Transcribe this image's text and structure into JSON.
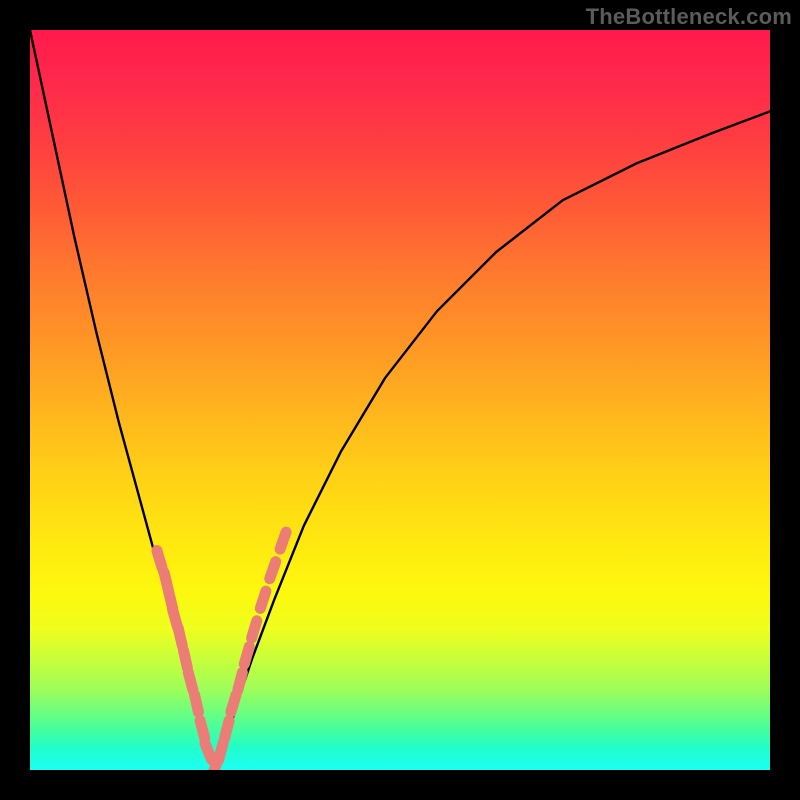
{
  "watermark": "TheBottleneck.com",
  "colors": {
    "frame": "#000000",
    "curve": "#000000",
    "marker": "#ec7d76",
    "gradient_stops": [
      "#ff1a4d",
      "#ff2b4a",
      "#ff4040",
      "#ff5a36",
      "#ff7a2e",
      "#ff9526",
      "#ffb31e",
      "#ffd016",
      "#ffe810",
      "#fdf80e",
      "#eefe1e",
      "#c8fe3a",
      "#9ffe59",
      "#6ffe7d",
      "#3efea4",
      "#21fecb",
      "#1cfff2"
    ]
  },
  "chart_data": {
    "type": "line",
    "title": "",
    "xlabel": "",
    "ylabel": "",
    "xlim": [
      0,
      100
    ],
    "ylim": [
      0,
      100
    ],
    "note": "V-shaped bottleneck curve. x is a normalized parameter (0–100), y is bottleneck percentage (0 at the balanced point, rising toward 100 away from it). Values are estimated from pixel positions; no axis ticks or labels are visible in the image.",
    "series": [
      {
        "name": "bottleneck-curve",
        "x": [
          0,
          3,
          6,
          9,
          12,
          15,
          18,
          20,
          22,
          23.5,
          25,
          26.5,
          28,
          30,
          33,
          37,
          42,
          48,
          55,
          63,
          72,
          82,
          92,
          100
        ],
        "y": [
          100,
          86,
          72,
          59,
          47,
          36,
          25,
          17,
          10,
          4,
          0,
          4,
          9,
          15,
          23,
          33,
          43,
          53,
          62,
          70,
          77,
          82,
          86,
          89
        ]
      }
    ],
    "markers": {
      "name": "highlighted-points",
      "note": "Salmon-colored marker segments clustered near the minimum of the curve.",
      "x": [
        17.5,
        18.4,
        19.0,
        19.6,
        20.3,
        21.0,
        21.7,
        22.5,
        23.3,
        24.1,
        25.0,
        25.8,
        26.6,
        27.5,
        28.4,
        29.3,
        30.3,
        31.5,
        32.8,
        34.2
      ],
      "y": [
        28.5,
        25.5,
        23.0,
        20.5,
        18.0,
        15.0,
        12.0,
        9.0,
        5.5,
        2.5,
        0.3,
        2.5,
        5.5,
        9.0,
        12.0,
        15.5,
        19.0,
        23.0,
        27.0,
        31.0
      ]
    }
  }
}
